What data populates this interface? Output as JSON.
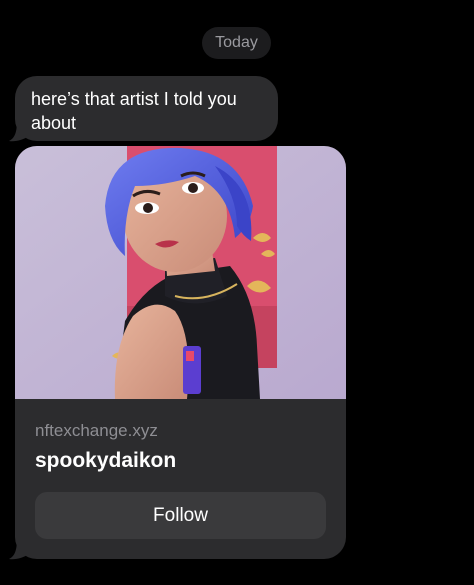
{
  "conversation": {
    "date_label": "Today",
    "message_text": "here’s that artist I told you about"
  },
  "link_preview": {
    "domain": "nftexchange.xyz",
    "title": "spookydaikon",
    "follow_label": "Follow",
    "image_alt": "3D illustration of a blue-haired woman in a black top against a pink background"
  },
  "colors": {
    "background": "#000000",
    "bubble": "#2c2c2e",
    "button": "#3a3a3c",
    "secondary_text": "#8e8e93"
  }
}
